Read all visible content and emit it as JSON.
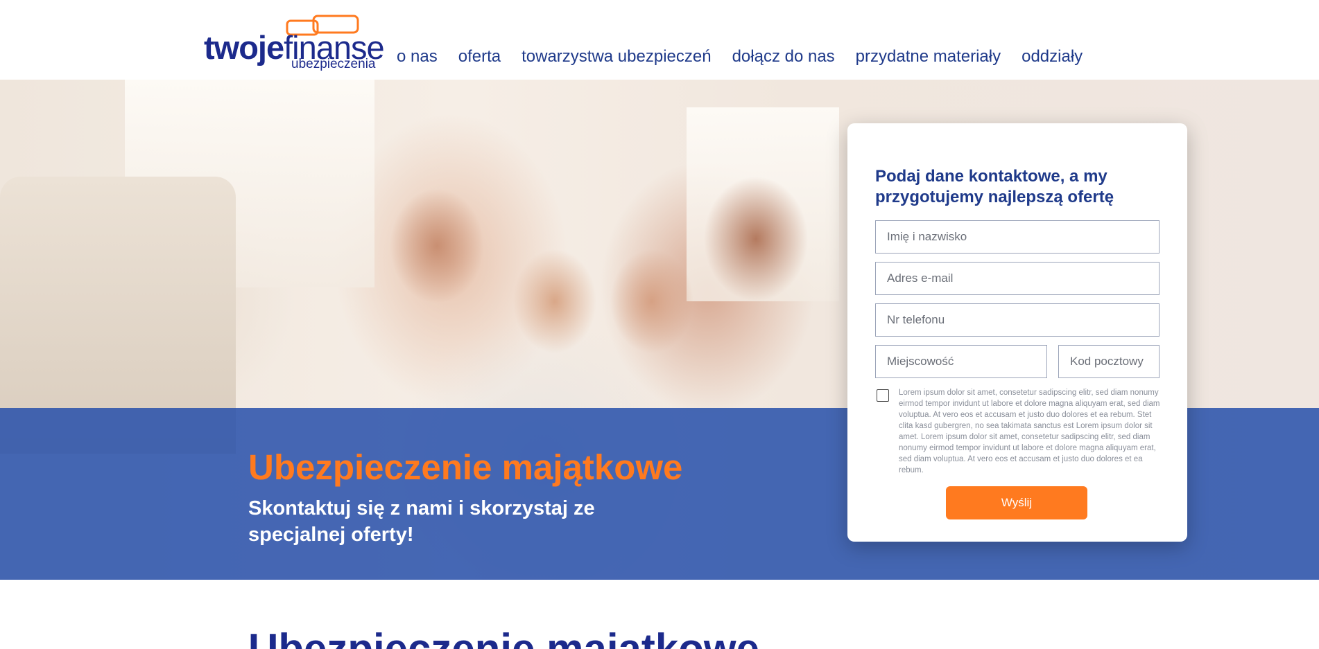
{
  "logo": {
    "word_bold": "twoje",
    "word_regular": "finanse",
    "sub": "ubezpieczenia"
  },
  "nav": {
    "items": [
      {
        "label": "o nas"
      },
      {
        "label": "oferta"
      },
      {
        "label": "towarzystwa ubezpieczeń"
      },
      {
        "label": "dołącz do nas"
      },
      {
        "label": "przydatne materiały"
      },
      {
        "label": "oddziały"
      }
    ]
  },
  "hero": {
    "title": "Ubezpieczenie majątkowe",
    "subtitle": "Skontaktuj się z nami i skorzystaj ze specjalnej oferty!"
  },
  "form": {
    "title": "Podaj dane kontaktowe, a my przygotujemy najlepszą ofertę",
    "name_placeholder": "Imię i nazwisko",
    "email_placeholder": "Adres e-mail",
    "phone_placeholder": "Nr telefonu",
    "city_placeholder": "Miejscowość",
    "zip_placeholder": "Kod pocztowy",
    "consent_text": "Lorem ipsum dolor sit amet, consetetur sadipscing elitr, sed diam nonumy eirmod tempor invidunt ut labore et dolore magna aliquyam erat, sed diam voluptua. At vero eos et accusam et justo duo dolores et ea rebum. Stet clita kasd gubergren, no sea takimata sanctus est Lorem ipsum dolor sit amet. Lorem ipsum dolor sit amet, consetetur sadipscing elitr, sed diam nonumy eirmod tempor invidunt ut labore et dolore magna aliquyam erat, sed diam voluptua. At vero eos et accusam et justo duo dolores et ea rebum.",
    "consent_checked": false,
    "submit_label": "Wyślij"
  },
  "section": {
    "title": "Ubezpieczenie majątkowe"
  },
  "colors": {
    "brand_blue": "#1c2a8c",
    "accent_orange": "#ff7a1f",
    "band_blue": "#264faa"
  }
}
